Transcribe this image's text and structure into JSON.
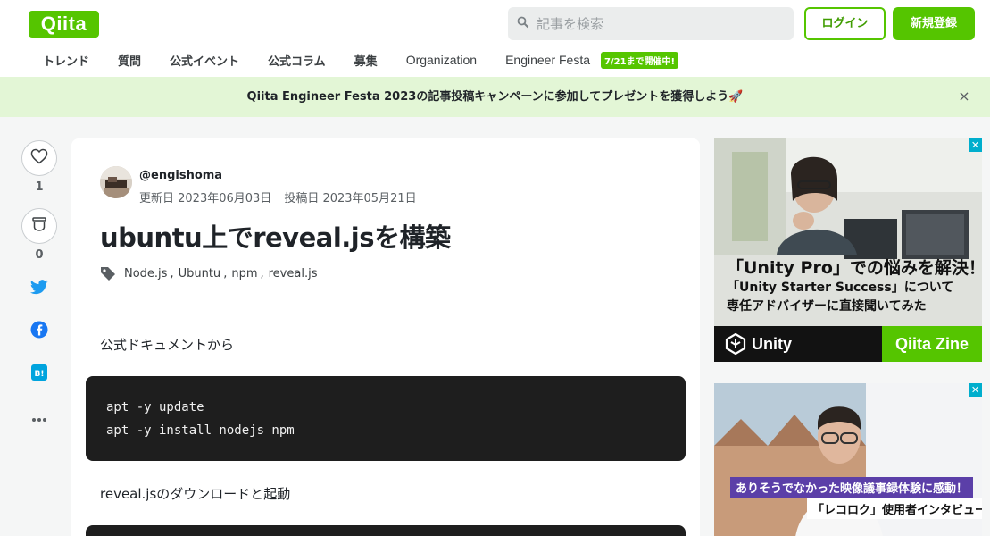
{
  "header": {
    "logo": "Qiita",
    "search_placeholder": "記事を検索",
    "login": "ログイン",
    "signup": "新規登録"
  },
  "nav": {
    "items": [
      "トレンド",
      "質問",
      "公式イベント",
      "公式コラム",
      "募集",
      "Organization",
      "Engineer Festa"
    ],
    "badge": "7/21まで開催中!"
  },
  "banner": {
    "text": "Qiita Engineer Festa 2023の記事投稿キャンペーンに参加してプレゼントを獲得しよう🚀",
    "close": "×"
  },
  "actions": {
    "like_count": "1",
    "stock_count": "0"
  },
  "article": {
    "user": "@engishoma",
    "updated": "更新日 2023年06月03日",
    "posted": "投稿日 2023年05月21日",
    "title": "ubuntu上でreveal.jsを構築",
    "tags": [
      "Node.js",
      "Ubuntu",
      "npm",
      "reveal.js"
    ],
    "paragraph1": "公式ドキュメントから",
    "code1": [
      "apt -y update",
      "apt -y install nodejs npm"
    ],
    "paragraph2": "reveal.jsのダウンロードと起動"
  },
  "ads": {
    "ad1": {
      "line1": "「Unity Pro」での悩みを解決！",
      "line2": "「Unity Starter Success」について",
      "line3": "専任アドバイザーに直接聞いてみた",
      "brand": "Unity",
      "partner": "Qiita Zine"
    },
    "ad2": {
      "caption1": "ありそうでなかった映像議事録体験に感動！",
      "caption2": "「レコロク」使用者インタビュー"
    }
  },
  "colors": {
    "brand": "#55c500",
    "banner_bg": "#e3f6d6",
    "code_bg": "#1e1e1e"
  }
}
